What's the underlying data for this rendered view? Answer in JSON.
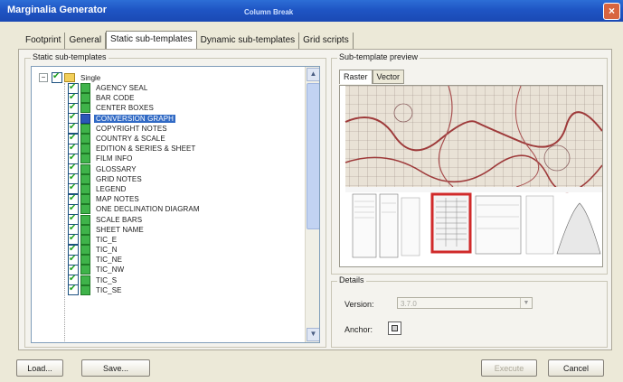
{
  "window": {
    "title": "Marginalia Generator",
    "subtitle": "Column Break",
    "close_glyph": "×"
  },
  "tabs": [
    {
      "label": "Footprint"
    },
    {
      "label": "General"
    },
    {
      "label": "Static sub-templates",
      "active": true
    },
    {
      "label": "Dynamic sub-templates"
    },
    {
      "label": "Grid scripts"
    }
  ],
  "static_group": {
    "label": "Static sub-templates",
    "root": {
      "label": "Single",
      "expander": "−"
    },
    "items": [
      {
        "label": "AGENCY SEAL"
      },
      {
        "label": "BAR CODE"
      },
      {
        "label": "CENTER BOXES"
      },
      {
        "label": "CONVERSION GRAPH",
        "selected": true
      },
      {
        "label": "COPYRIGHT NOTES"
      },
      {
        "label": "COUNTRY & SCALE"
      },
      {
        "label": "EDITION & SERIES & SHEET"
      },
      {
        "label": "FILM INFO"
      },
      {
        "label": "GLOSSARY"
      },
      {
        "label": "GRID NOTES"
      },
      {
        "label": "LEGEND"
      },
      {
        "label": "MAP NOTES"
      },
      {
        "label": "ONE DECLINATION DIAGRAM"
      },
      {
        "label": "SCALE BARS"
      },
      {
        "label": "SHEET NAME"
      },
      {
        "label": "TIC_E"
      },
      {
        "label": "TIC_N"
      },
      {
        "label": "TIC_NE"
      },
      {
        "label": "TIC_NW"
      },
      {
        "label": "TIC_S"
      },
      {
        "label": "TIC_SE"
      }
    ],
    "scroll_up": "▲",
    "scroll_down": "▼"
  },
  "preview_group": {
    "label": "Sub-template preview",
    "tabs": [
      {
        "label": "Raster",
        "active": true
      },
      {
        "label": "Vector"
      }
    ]
  },
  "details_group": {
    "label": "Details",
    "version_label": "Version:",
    "version_value": "3.7.0",
    "version_arrow": "▼",
    "anchor_label": "Anchor:"
  },
  "buttons": {
    "load": "Load...",
    "save": "Save...",
    "execute": "Execute",
    "cancel": "Cancel"
  },
  "colors": {
    "title_bar": "#1f55c4",
    "selection": "#316ac5",
    "highlight_box": "#d02a2a"
  },
  "icons": {
    "checkbox": "checkbox-icon",
    "template": "template-icon",
    "folder": "folder-icon"
  }
}
